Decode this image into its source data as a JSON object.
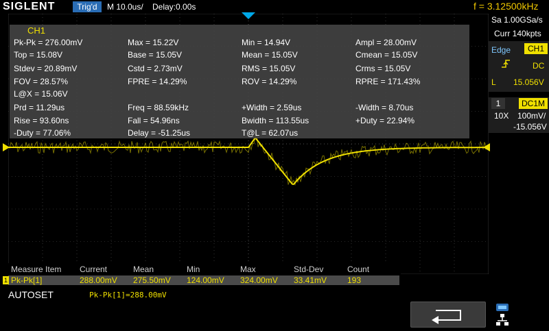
{
  "topbar": {
    "logo": "SIGLENT",
    "trigger_status": "Trig'd",
    "timebase": "M 10.0us/",
    "delay": "Delay:0.00s",
    "frequency": "f = 3.12500kHz"
  },
  "measurements": {
    "channel": "CH1",
    "rows": [
      [
        "Pk-Pk = 276.00mV",
        "Max = 15.22V",
        "Min = 14.94V",
        "Ampl = 28.00mV"
      ],
      [
        "Top = 15.08V",
        "Base = 15.05V",
        "Mean = 15.05V",
        "Cmean = 15.05V"
      ],
      [
        "Stdev = 20.89mV",
        "Cstd = 2.73mV",
        "RMS = 15.05V",
        "Crms = 15.05V"
      ],
      [
        "FOV = 28.57%",
        "FPRE = 14.29%",
        "ROV = 14.29%",
        "RPRE = 171.43%"
      ],
      [
        "L@X = 15.06V"
      ],
      [
        "Prd = 11.29us",
        "Freq = 88.59kHz",
        "+Width = 2.59us",
        "-Width = 8.70us"
      ],
      [
        "Rise = 93.60ns",
        "Fall = 54.96ns",
        "Bwidth = 113.55us",
        "+Duty = 22.94%"
      ],
      [
        "-Duty = 77.06%",
        "Delay = -51.25us",
        "T@L = 62.07us"
      ]
    ]
  },
  "acquisition": {
    "sample_rate": "Sa 1.00GSa/s",
    "memory_depth": "Curr 140kpts"
  },
  "trigger": {
    "type": "Edge",
    "source": "CH1",
    "coupling": "DC",
    "level_label": "L",
    "level": "15.056V"
  },
  "channel": {
    "number": "1",
    "coupling": "DC1M",
    "probe": "10X",
    "scale": "100mV/",
    "offset": "-15.056V"
  },
  "statistics": {
    "headers": [
      "Measure Item",
      "Current",
      "Mean",
      "Min",
      "Max",
      "Std-Dev",
      "Count"
    ],
    "row": [
      "Pk-Pk[1]",
      "288.00mV",
      "275.50mV",
      "124.00mV",
      "324.00mV",
      "33.41mV",
      "193"
    ],
    "marker": "1"
  },
  "footer": {
    "autoset": "AUTOSET",
    "status": "Pk-Pk[1]=288.00mV"
  },
  "colors": {
    "trace": "#f0e000",
    "trigger_marker": "#00a8e8",
    "grid": "#555555",
    "accent": "#2a6db5"
  },
  "icons": {
    "back": "return-arrow-icon",
    "network": "network-icon"
  }
}
